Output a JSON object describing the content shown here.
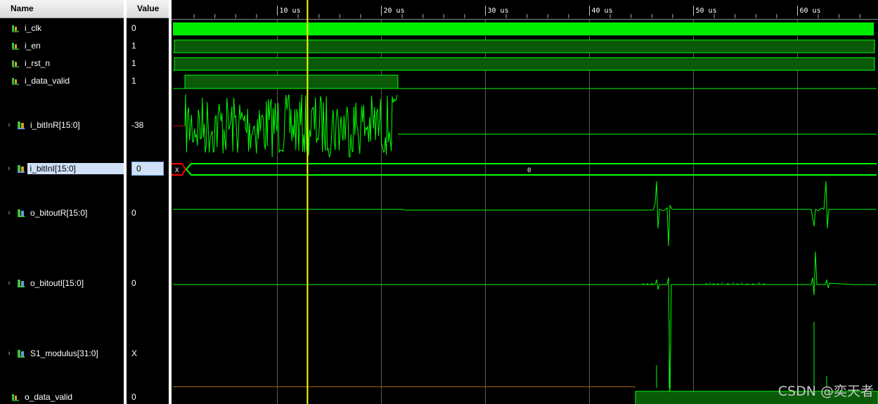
{
  "columns": {
    "name": "Name",
    "value": "Value"
  },
  "signals": [
    {
      "name": "i_clk",
      "value": "0",
      "icon": "scalar-signal-icon"
    },
    {
      "name": "i_en",
      "value": "1",
      "icon": "scalar-signal-icon"
    },
    {
      "name": "i_rst_n",
      "value": "1",
      "icon": "scalar-signal-icon"
    },
    {
      "name": "i_data_valid",
      "value": "1",
      "icon": "scalar-signal-icon"
    },
    {
      "name": "i_bitInR[15:0]",
      "value": "-38",
      "icon": "bus-signal-icon"
    },
    {
      "name": "i_bitInI[15:0]",
      "value": "0",
      "icon": "bus-signal-icon"
    },
    {
      "name": "o_bitoutR[15:0]",
      "value": "0",
      "icon": "bus-signal-icon"
    },
    {
      "name": "o_bitoutI[15:0]",
      "value": "0",
      "icon": "bus-signal-icon"
    },
    {
      "name": "S1_modulus[31:0]",
      "value": "X",
      "icon": "bus-signal-icon"
    },
    {
      "name": "o_data_valid",
      "value": "0",
      "icon": "scalar-signal-icon"
    }
  ],
  "timeline": {
    "ticks": [
      "10 us",
      "20 us",
      "30 us",
      "40 us",
      "50 us",
      "60 us"
    ],
    "cursor_time_us": 12.9
  },
  "bus_labels": {
    "undefined": "X",
    "zero": "0"
  },
  "watermark": "CSDN @奕天者",
  "colors": {
    "waveform": "#00ff00",
    "cursor": "#ffff00",
    "undefined": "#ff0000",
    "grid": "#5a5a5a"
  }
}
